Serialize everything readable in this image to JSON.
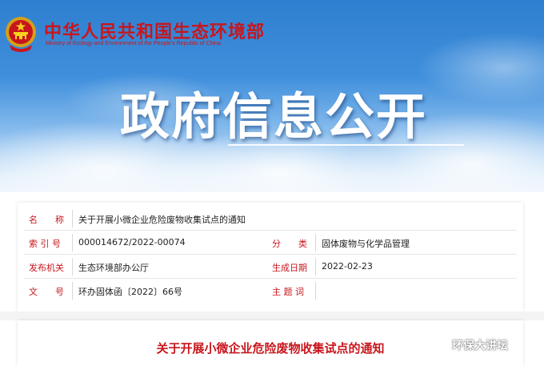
{
  "header": {
    "ministry_cn": "中华人民共和国生态环境部",
    "ministry_en": "Ministry of Ecology and Environment of the People's Republic of China",
    "banner_title": "政府信息公开",
    "emblem_icon": "national-emblem-icon"
  },
  "info": {
    "name_label": "名　　称",
    "name_value": "关于开展小微企业危险废物收集试点的通知",
    "index_label": "索 引 号",
    "index_value": "000014672/2022-00074",
    "category_label": "分　　类",
    "category_value": "固体废物与化学品管理",
    "issuer_label": "发布机关",
    "issuer_value": "生态环境部办公厅",
    "date_label": "生成日期",
    "date_value": "2022-02-23",
    "docno_label": "文　　号",
    "docno_value": "环办固体函〔2022〕66号",
    "subject_label": "主 题 词",
    "subject_value": ""
  },
  "content": {
    "title": "关于开展小微企业危险废物收集试点的通知"
  },
  "watermark": {
    "text": "环保大讲坛",
    "icon": "wechat-icon"
  },
  "colors": {
    "accent_red": "#c8161d",
    "sky_blue": "#2f7fd0"
  }
}
